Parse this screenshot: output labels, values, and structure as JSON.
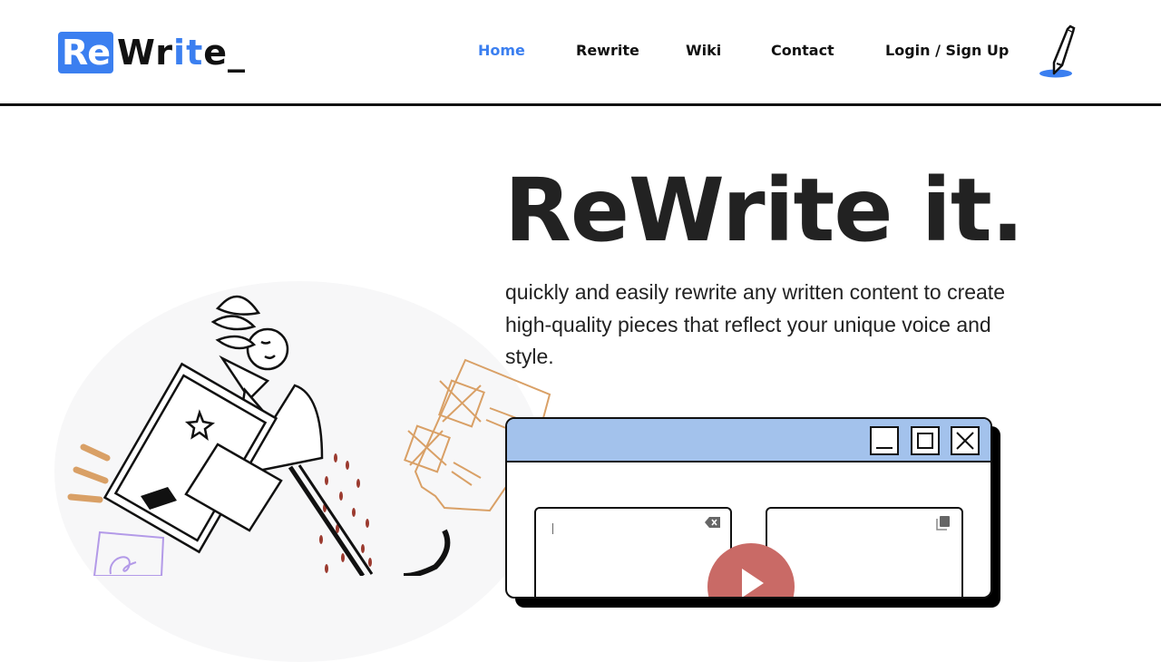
{
  "logo": {
    "boxed": "Re",
    "part1": "Wr",
    "part2": "it",
    "part3": "e_"
  },
  "nav": {
    "items": [
      {
        "label": "Home",
        "active": true
      },
      {
        "label": "Rewrite",
        "active": false
      },
      {
        "label": "Wiki",
        "active": false
      },
      {
        "label": "Contact",
        "active": false
      },
      {
        "label": "Login / Sign Up",
        "active": false
      }
    ],
    "icon": "pen-icon"
  },
  "hero": {
    "title": "ReWrite it.",
    "subtitle": "quickly and easily rewrite any written content to create high-quality pieces that reflect your unique voice and style."
  },
  "window": {
    "controls": [
      "minimize-icon",
      "maximize-icon",
      "close-icon"
    ],
    "input": {
      "value": "",
      "clear_icon": "backspace-clear-icon"
    },
    "output": {
      "value": "",
      "copy_icon": "copy-icon"
    },
    "play_icon": "play-icon"
  },
  "colors": {
    "accent": "#3b7ff0",
    "window_bar": "#a3c2ec",
    "play": "#c96a66",
    "paper": "#d9a066",
    "dots": "#9b3a2f"
  }
}
